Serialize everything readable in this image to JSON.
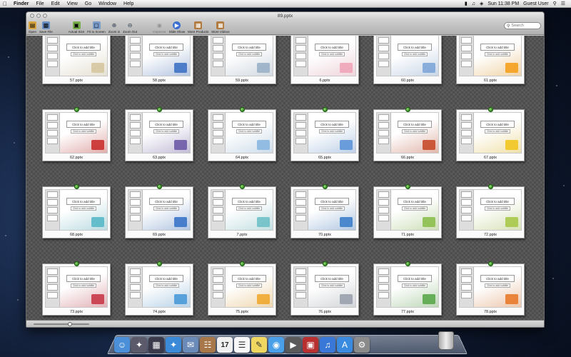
{
  "menubar": {
    "app": "Finder",
    "items": [
      "File",
      "Edit",
      "View",
      "Go",
      "Window",
      "Help"
    ],
    "clock": "Sun 11:38 PM",
    "user": "Guest User"
  },
  "window": {
    "title": "89.pptx",
    "toolbar": [
      {
        "label": "Open",
        "icon": "folder-icon",
        "color": "#d9a441"
      },
      {
        "label": "Save File",
        "icon": "save-icon",
        "color": "#6a8fc4"
      },
      {
        "label": "Actual Size",
        "icon": "actual-size-icon",
        "color": "#7ab04c"
      },
      {
        "label": "Fit to Screen",
        "icon": "fit-screen-icon",
        "color": "#7a9cc8"
      },
      {
        "label": "Zoom in",
        "icon": "zoom-in-icon",
        "color": "#8899bb"
      },
      {
        "label": "Zoom Out",
        "icon": "zoom-out-icon",
        "color": "#8899bb"
      },
      {
        "label": "Inspector",
        "icon": "inspector-icon",
        "color": "#b8b8c8"
      },
      {
        "label": "Slide Show",
        "icon": "slide-show-icon",
        "color": "#3b6fd1"
      },
      {
        "label": "More Products",
        "icon": "box-icon",
        "color": "#b07a3e"
      },
      {
        "label": "More Videos",
        "icon": "box-icon",
        "color": "#b07a3e"
      }
    ],
    "search_placeholder": "Search"
  },
  "slide_text": {
    "title": "Click to add title",
    "subtitle": "Click to add subtitle"
  },
  "files": [
    {
      "name": "57.pptx",
      "accent": "#d6c6a0"
    },
    {
      "name": "58.pptx",
      "accent": "#3f72c4"
    },
    {
      "name": "59.pptx",
      "accent": "#9ab0c8"
    },
    {
      "name": "6.pptx",
      "accent": "#f0a4b8"
    },
    {
      "name": "60.pptx",
      "accent": "#7fa6d8"
    },
    {
      "name": "61.pptx",
      "accent": "#f5a01e"
    },
    {
      "name": "62.pptx",
      "accent": "#c9302c"
    },
    {
      "name": "63.pptx",
      "accent": "#6d5aa8"
    },
    {
      "name": "64.pptx",
      "accent": "#8ab7e0"
    },
    {
      "name": "65.pptx",
      "accent": "#5d95d8"
    },
    {
      "name": "66.pptx",
      "accent": "#c84a2a"
    },
    {
      "name": "67.pptx",
      "accent": "#f3c521"
    },
    {
      "name": "68.pptx",
      "accent": "#58b8c8"
    },
    {
      "name": "69.pptx",
      "accent": "#3a74c8"
    },
    {
      "name": "7.pptx",
      "accent": "#6fc0c8"
    },
    {
      "name": "70.pptx",
      "accent": "#3d7ec9"
    },
    {
      "name": "71.pptx",
      "accent": "#8cbf4e"
    },
    {
      "name": "72.pptx",
      "accent": "#a8c84a"
    },
    {
      "name": "73.pptx",
      "accent": "#c83a4a"
    },
    {
      "name": "74.pptx",
      "accent": "#4a9ad8"
    },
    {
      "name": "75.pptx",
      "accent": "#f0a830"
    },
    {
      "name": "76.pptx",
      "accent": "#9aa2ae"
    },
    {
      "name": "77.pptx",
      "accent": "#5aa84a"
    },
    {
      "name": "78.pptx",
      "accent": "#e87a2a"
    }
  ],
  "dock": [
    {
      "icon": "finder-icon",
      "color": "#4a8fd8"
    },
    {
      "icon": "launchpad-icon",
      "color": "#5a5a6a"
    },
    {
      "icon": "mission-control-icon",
      "color": "#3a3a4a"
    },
    {
      "icon": "safari-icon",
      "color": "#3a8ad8"
    },
    {
      "icon": "mail-icon",
      "color": "#6a8ab8"
    },
    {
      "icon": "contacts-icon",
      "color": "#a8784a"
    },
    {
      "icon": "calendar-icon",
      "color": "#f0f0f0"
    },
    {
      "icon": "reminders-icon",
      "color": "#f8f8f8"
    },
    {
      "icon": "notes-icon",
      "color": "#f0d860"
    },
    {
      "icon": "messages-icon",
      "color": "#4aa0e8"
    },
    {
      "icon": "facetime-icon",
      "color": "#5a5a5a"
    },
    {
      "icon": "photo-booth-icon",
      "color": "#b83030"
    },
    {
      "icon": "itunes-icon",
      "color": "#3a78d8"
    },
    {
      "icon": "app-store-icon",
      "color": "#3a8ae0"
    },
    {
      "icon": "system-preferences-icon",
      "color": "#8a8a8a"
    }
  ],
  "calendar_day": "17"
}
